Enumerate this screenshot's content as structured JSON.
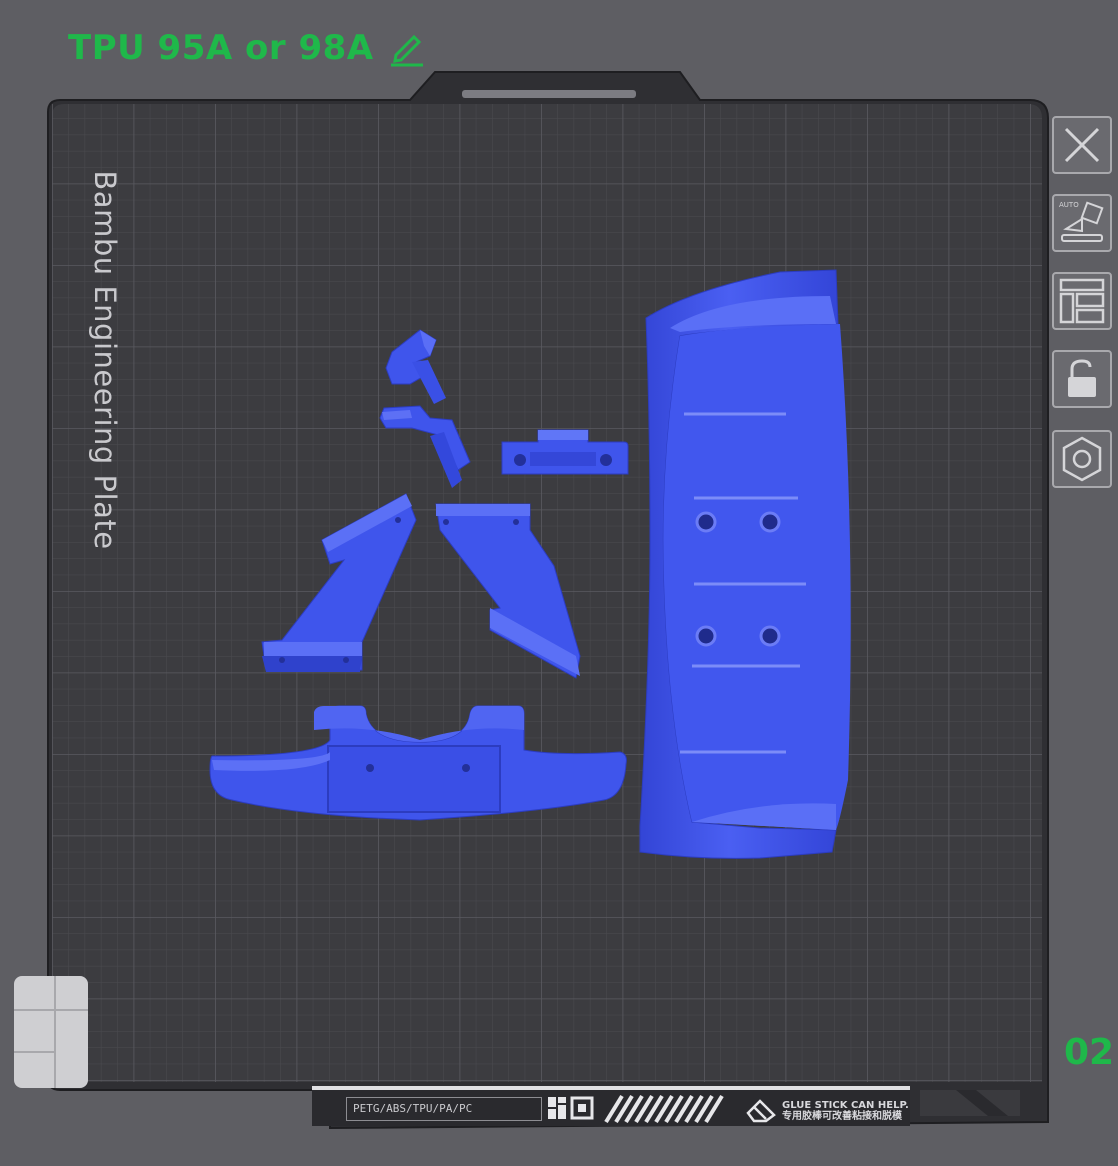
{
  "plate": {
    "title": "TPU 95A or 98A",
    "name": "Bambu Engineering Plate",
    "number": "02",
    "material_strip": "PETG/ABS/TPU/PA/PC",
    "glue_line1": "GLUE STICK CAN HELP.",
    "glue_line2": "专用胶棒可改善粘接和脱模"
  },
  "toolbar": {
    "buttons": [
      {
        "name": "close",
        "icon": "close-icon"
      },
      {
        "name": "auto-orient",
        "icon": "auto-orient-icon",
        "badge": "AUTO"
      },
      {
        "name": "arrange",
        "icon": "arrange-icon"
      },
      {
        "name": "lock",
        "icon": "lock-icon"
      },
      {
        "name": "settings",
        "icon": "hex-settings-icon"
      }
    ]
  },
  "colors": {
    "background": "#5e5e63",
    "plate": "#3c3c40",
    "grid": "#505055",
    "accent": "#1fb84a",
    "model": "#3f55ec"
  },
  "models": [
    {
      "name": "zigzag-bracket",
      "icon": "model-part"
    },
    {
      "name": "mount-clip",
      "icon": "model-part"
    },
    {
      "name": "left-wing-strut",
      "icon": "model-part"
    },
    {
      "name": "right-wing-strut",
      "icon": "model-part"
    },
    {
      "name": "front-bumper",
      "icon": "model-part"
    },
    {
      "name": "rear-wing",
      "icon": "model-part"
    }
  ]
}
